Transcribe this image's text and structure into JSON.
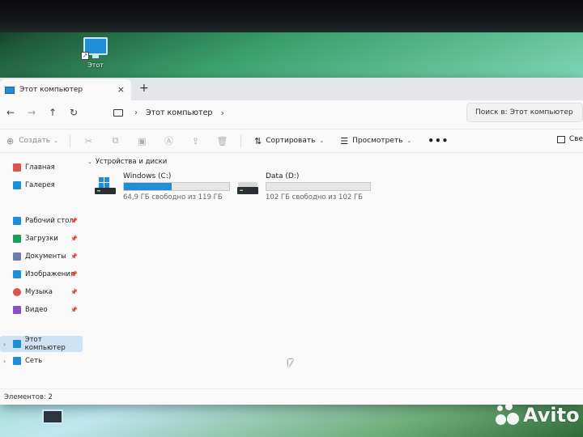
{
  "desktop": {
    "icon_label": "Этот",
    "icon_name": "this-pc-icon"
  },
  "window": {
    "tab_title": "Этот компьютер",
    "new_tab_glyph": "+",
    "close_glyph": "×"
  },
  "address": {
    "back": "←",
    "forward": "→",
    "up": "↑",
    "refresh": "↻",
    "chevron": "›",
    "path": "Этот компьютер",
    "search_placeholder": "Поиск в: Этот компьютер"
  },
  "toolbar": {
    "create_label": "Создать",
    "sort_label": "Сортировать",
    "view_label": "Просмотреть",
    "more_glyph": "•••",
    "details_label": "Све"
  },
  "sidebar": {
    "items": [
      {
        "label": "Главная",
        "icon": "home-icon",
        "color": "#d9534f"
      },
      {
        "label": "Галерея",
        "icon": "gallery-icon",
        "color": "#1f8ed6"
      },
      {
        "label": "Рабочий стол",
        "icon": "desktop-icon",
        "color": "#1f8ed6"
      },
      {
        "label": "Загрузки",
        "icon": "downloads-icon",
        "color": "#1a9e5a"
      },
      {
        "label": "Документы",
        "icon": "documents-icon",
        "color": "#6b7fa8"
      },
      {
        "label": "Изображения",
        "icon": "pictures-icon",
        "color": "#1f8ed6"
      },
      {
        "label": "Музыка",
        "icon": "music-icon",
        "color": "#d9534f"
      },
      {
        "label": "Видео",
        "icon": "videos-icon",
        "color": "#8a4fc7"
      },
      {
        "label": "Этот компьютер",
        "icon": "this-pc-icon",
        "color": "#1f8ed6"
      },
      {
        "label": "Сеть",
        "icon": "network-icon",
        "color": "#1f8ed6"
      }
    ]
  },
  "content": {
    "group_title": "Устройства и диски",
    "drives": [
      {
        "name": "Windows (C:)",
        "free_text": "64,9 ГБ свободно из 119 ГБ",
        "used_fraction": 0.45
      },
      {
        "name": "Data (D:)",
        "free_text": "102 ГБ свободно из 102 ГБ",
        "used_fraction": 0.0
      }
    ]
  },
  "status": {
    "items_text": "Элементов: 2"
  },
  "watermark": {
    "text": "Avito"
  }
}
